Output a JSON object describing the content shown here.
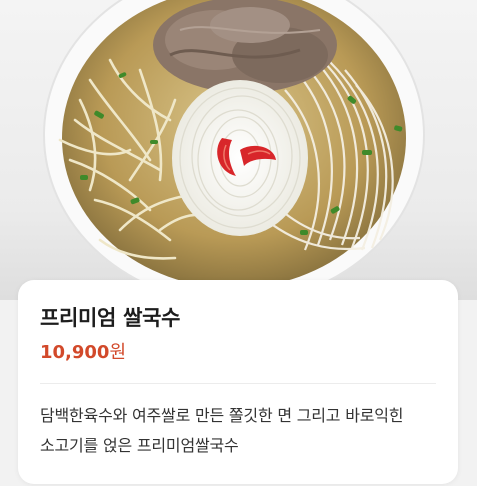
{
  "product": {
    "name": "프리미엄 쌀국수",
    "price_amount": "10,900",
    "price_unit": "원",
    "description": "담백한육수와 여주쌀로 만든 쫄깃한 면 그리고 바로익힌 소고기를 얹은 프리미엄쌀국수"
  },
  "colors": {
    "price": "#d2492a",
    "title": "#1d1d1d",
    "card_background": "#ffffff",
    "page_background": "#f2f2f2"
  },
  "image": {
    "subject": "pho-noodle-bowl"
  }
}
